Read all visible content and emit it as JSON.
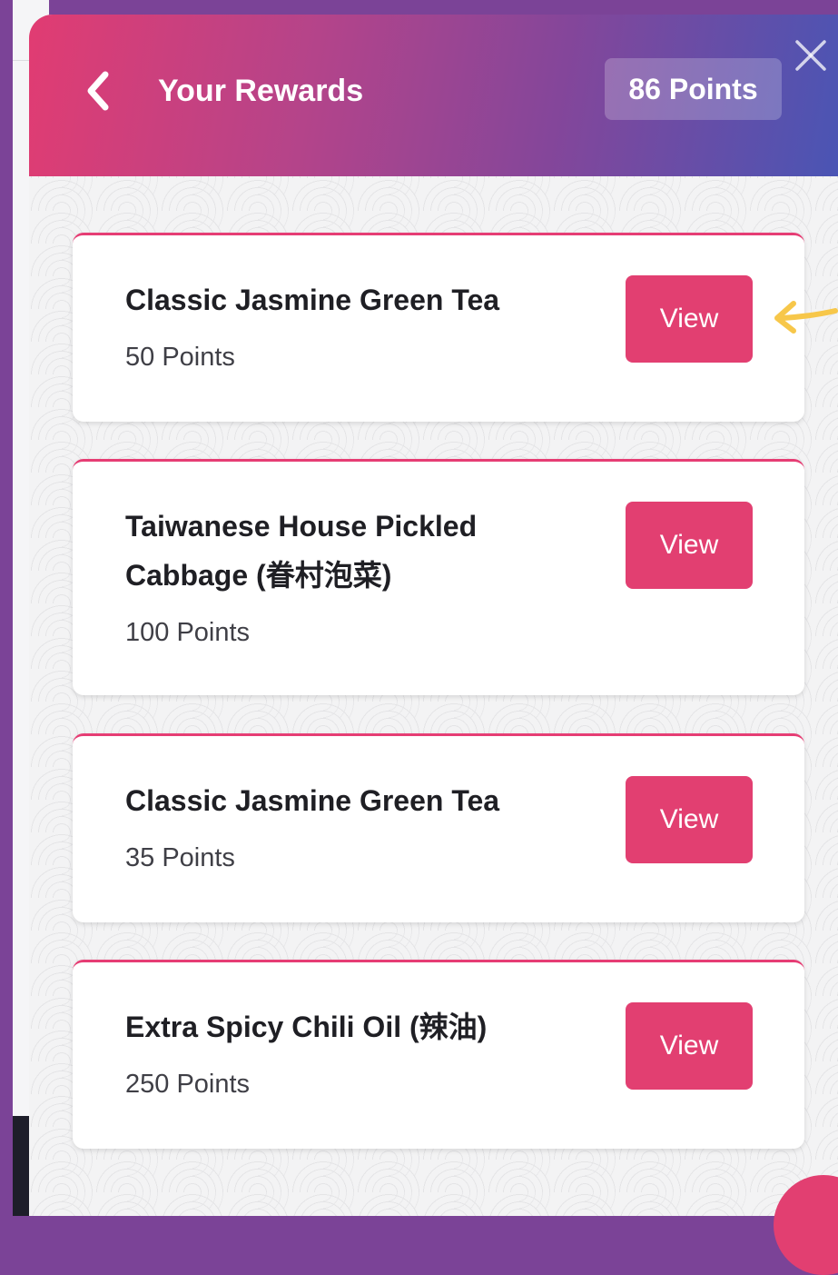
{
  "header": {
    "title": "Your Rewards",
    "points_badge": "86 Points",
    "back_icon": "chevron-left-icon",
    "close_icon": "close-icon"
  },
  "rewards": [
    {
      "name": "Classic Jasmine Green Tea",
      "points": "50 Points",
      "button_label": "View"
    },
    {
      "name": "Taiwanese House Pickled Cabbage (眷村泡菜)",
      "points": "100 Points",
      "button_label": "View"
    },
    {
      "name": "Classic Jasmine Green Tea",
      "points": "35 Points",
      "button_label": "View"
    },
    {
      "name": "Extra Spicy Chili Oil (辣油)",
      "points": "250 Points",
      "button_label": "View"
    }
  ],
  "annotation": {
    "icon": "arrow-left-icon",
    "color": "#f7c74a"
  },
  "colors": {
    "accent": "#e23f71",
    "header_gradient": [
      "#e13c72",
      "#84469a",
      "#4a55b4"
    ],
    "page_background": "#7b4397"
  }
}
